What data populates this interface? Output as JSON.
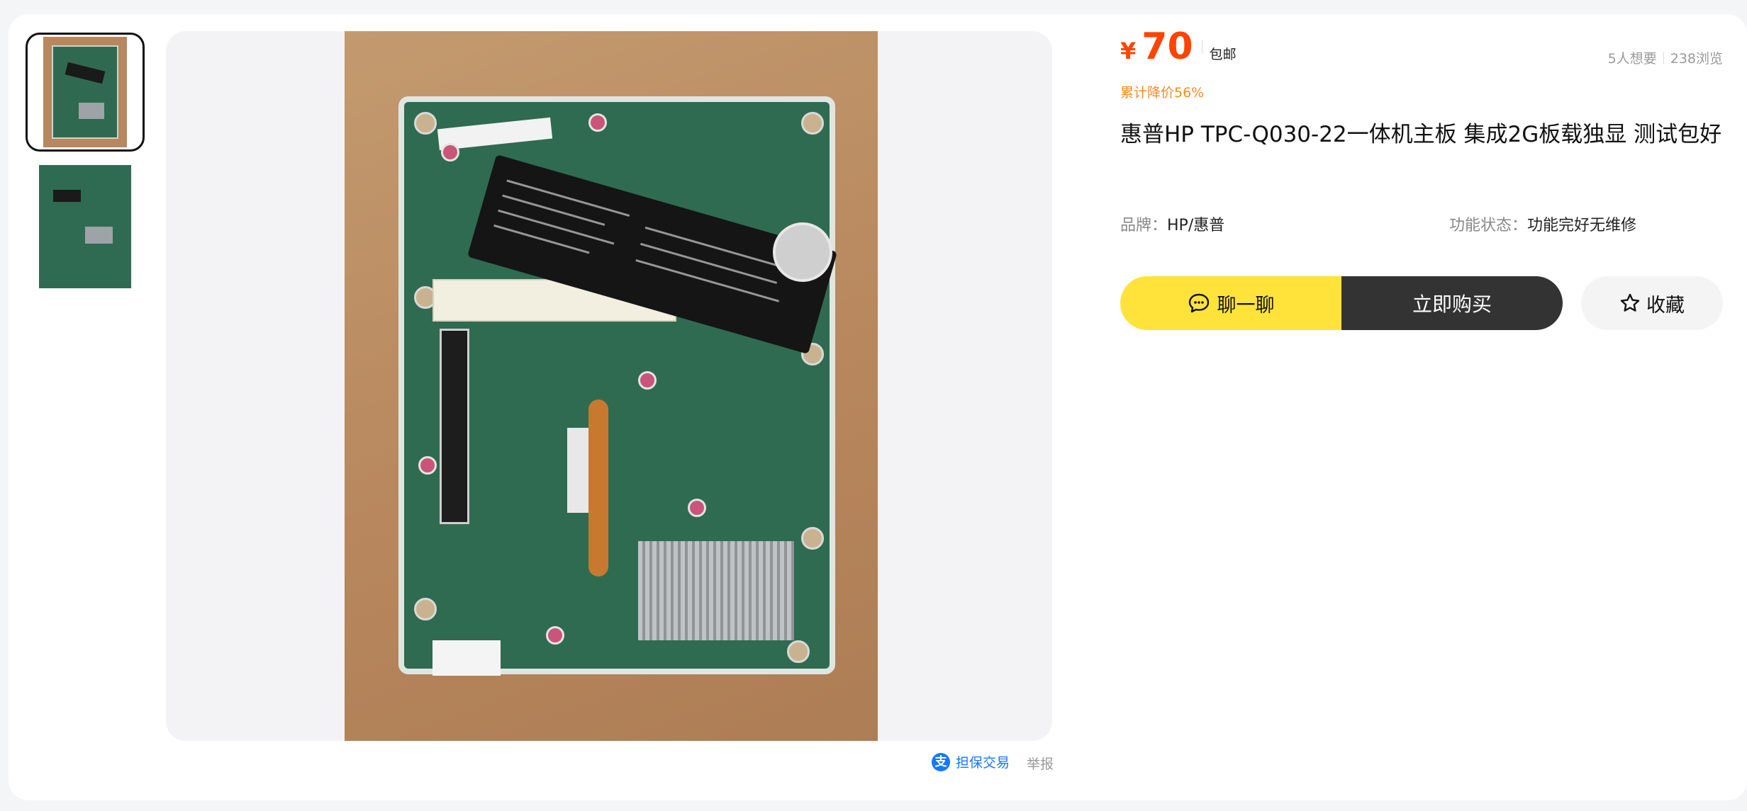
{
  "price": {
    "currency": "¥",
    "amount": "70",
    "shipping": "包邮",
    "discount": "累计降价56%"
  },
  "stats": {
    "wants": "5人想要",
    "views": "238浏览"
  },
  "product": {
    "title": "惠普HP TPC-Q030-22一体机主板 集成2G板载独显 测试包好",
    "attributes": [
      {
        "key": "品牌：",
        "value": "HP/惠普"
      },
      {
        "key": "功能状态：",
        "value": "功能完好无维修"
      }
    ]
  },
  "buttons": {
    "chat": "聊一聊",
    "buy": "立即购买",
    "favorite": "收藏"
  },
  "footer": {
    "guarantee": "担保交易",
    "guarantee_icon_char": "支",
    "report": "举报"
  },
  "icons": {
    "chat": "chat-bubble-icon",
    "favorite": "star-icon",
    "guarantee": "alipay-icon"
  },
  "colors": {
    "price": "#ff4400",
    "discount": "#ff8a1f",
    "chat_button": "#ffe33b",
    "buy_button": "#333333",
    "favorite_button": "#f4f4f4",
    "link": "#1677ff"
  }
}
